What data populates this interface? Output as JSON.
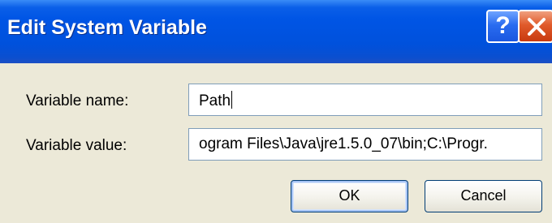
{
  "window": {
    "title": "Edit System Variable",
    "help_label": "?"
  },
  "form": {
    "name_label": "Variable name:",
    "name_value": "Path",
    "value_label": "Variable value:",
    "value_value": "ogram Files\\Java\\jre1.5.0_07\\bin;C:\\Progr."
  },
  "buttons": {
    "ok_label": "OK",
    "cancel_label": "Cancel"
  },
  "icons": {
    "help": "help-icon",
    "close": "close-icon"
  }
}
